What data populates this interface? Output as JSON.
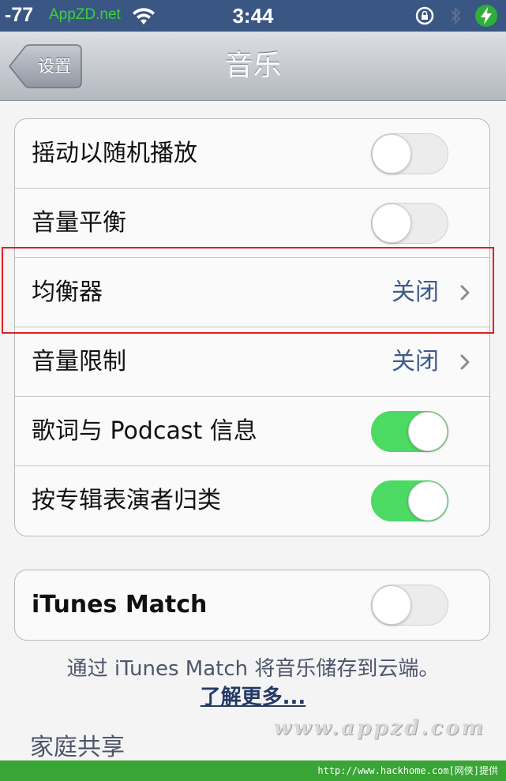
{
  "status_bar": {
    "signal": "-77",
    "carrier": "AppZD.net",
    "time": "3:44"
  },
  "nav": {
    "title": "音乐",
    "back_label": "设置"
  },
  "group1": {
    "rows": [
      {
        "label": "摇动以随机播放",
        "type": "toggle",
        "state": "off"
      },
      {
        "label": "音量平衡",
        "type": "toggle",
        "state": "off"
      },
      {
        "label": "均衡器",
        "type": "disclosure",
        "value": "关闭"
      },
      {
        "label": "音量限制",
        "type": "disclosure",
        "value": "关闭"
      },
      {
        "label": "歌词与 Podcast 信息",
        "type": "toggle",
        "state": "on"
      },
      {
        "label": "按专辑表演者归类",
        "type": "toggle",
        "state": "on"
      }
    ]
  },
  "group2": {
    "rows": [
      {
        "label": "iTunes Match",
        "type": "toggle",
        "state": "off"
      }
    ],
    "footer": "通过 iTunes Match 将音乐储存到云端。",
    "learn_more": "了解更多..."
  },
  "section_header": "家庭共享",
  "watermark": "www.appzd.com",
  "bottom_bar_text": "http://www.hackhome.com[网侠]提供",
  "colors": {
    "statusbar": "#3a5683",
    "toggle_on": "#4cd964",
    "value_text": "#3f5b8b",
    "highlight": "#e02020"
  }
}
